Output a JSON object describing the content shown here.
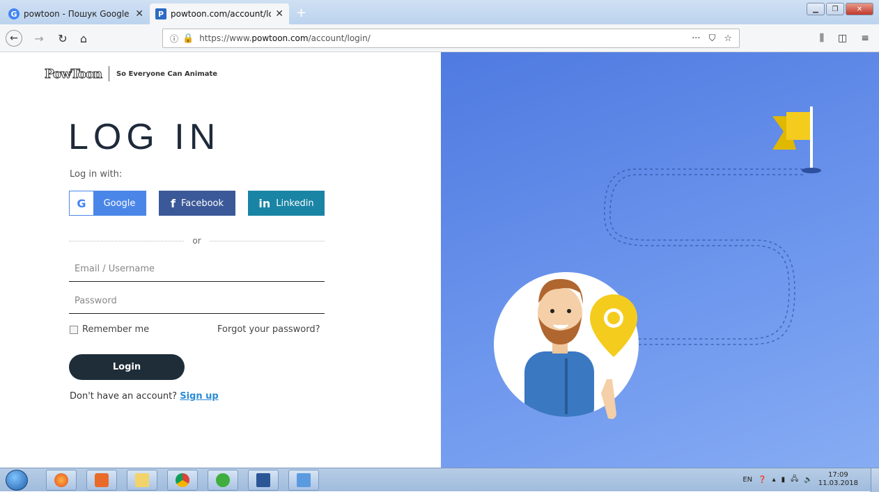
{
  "browser": {
    "tabs": [
      {
        "title": "powtoon - Пошук Google",
        "active": false
      },
      {
        "title": "powtoon.com/account/login/",
        "active": true
      }
    ],
    "url_prefix": "https://www.",
    "url_domain": "powtoon.com",
    "url_path": "/account/login/"
  },
  "brand": {
    "logo_text": "PowToon",
    "tagline": "So Everyone Can Animate"
  },
  "login": {
    "heading": "LOG IN",
    "login_with_label": "Log in with:",
    "google_label": "Google",
    "facebook_label": "Facebook",
    "linkedin_label": "Linkedin",
    "or_label": "or",
    "email_placeholder": "Email / Username",
    "password_placeholder": "Password",
    "remember_label": "Remember me",
    "forgot_label": "Forgot your password?",
    "submit_label": "Login",
    "no_account_text": "Don't have an account?",
    "signup_label": "Sign up"
  },
  "taskbar": {
    "language": "EN",
    "time": "17:09",
    "date": "11.03.2018"
  },
  "colors": {
    "google_blue": "#4a86e8",
    "facebook_blue": "#3b5998",
    "linkedin_teal": "#1a84a5",
    "login_button": "#1e2d38",
    "signup_link": "#2a8bd6",
    "panel_blue": "#5b84e6"
  }
}
